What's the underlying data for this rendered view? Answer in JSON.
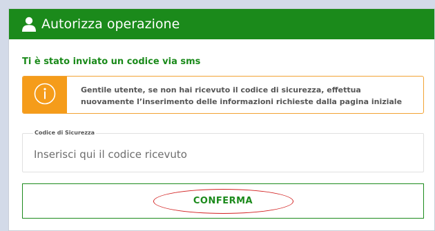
{
  "header": {
    "title": "Autorizza operazione",
    "icon": "user-icon",
    "background": "#1b8a1b"
  },
  "subtitle": "Ti è stato inviato un codice via sms",
  "alert": {
    "icon": "info-icon",
    "message": "Gentile utente, se non hai ricevuto il codice di sicurezza, effettua nuovamente l’inserimento delle informazioni richieste dalla pagina iniziale",
    "accent": "#f59c1a"
  },
  "security_field": {
    "label": "Codice di Sicurezza",
    "placeholder": "Inserisci qui il codice ricevuto",
    "value": ""
  },
  "confirm_button": {
    "label": "CONFERMA",
    "highlight_color": "#d21f1f"
  }
}
